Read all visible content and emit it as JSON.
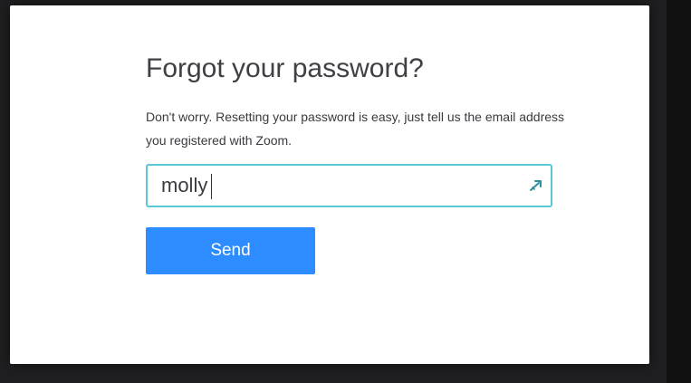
{
  "dialog": {
    "title": "Forgot your password?",
    "description": "Don't worry. Resetting your password is easy, just tell us the email address you registered with Zoom.",
    "email_field": {
      "value": "molly",
      "placeholder": "",
      "icon": "autofill-key-icon"
    },
    "send_button": {
      "label": "Send"
    }
  },
  "colors": {
    "button": "#2d8cff",
    "field_border": "#5bc8d6",
    "title_text": "#3f3f45"
  }
}
